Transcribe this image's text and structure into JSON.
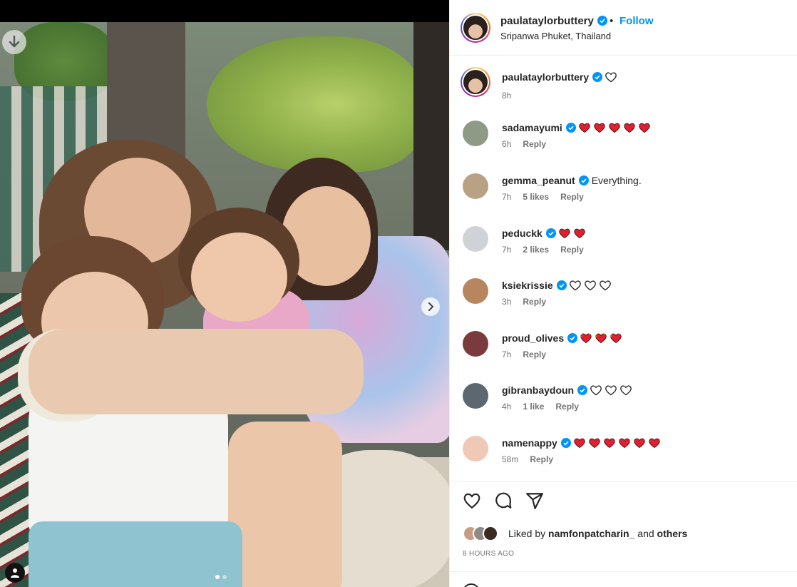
{
  "post": {
    "author": "paulataylorbuttery",
    "location": "Sripanwa Phuket, Thailand",
    "separator": "•",
    "follow_label": "Follow",
    "caption_time": "8h"
  },
  "comments": [
    {
      "username": "sadamayumi",
      "text": "",
      "hearts": 5,
      "heart_style": "red",
      "time": "6h",
      "likes": "",
      "reply": "Reply",
      "avatar_color": "#8f9a86"
    },
    {
      "username": "gemma_peanut",
      "text": "Everything.",
      "hearts": 0,
      "heart_style": "",
      "time": "7h",
      "likes": "5 likes",
      "reply": "Reply",
      "avatar_color": "#b9a184"
    },
    {
      "username": "peduckk",
      "text": "",
      "hearts": 2,
      "heart_style": "red",
      "time": "7h",
      "likes": "2 likes",
      "reply": "Reply",
      "avatar_color": "#cfd3d8"
    },
    {
      "username": "ksiekrissie",
      "text": "",
      "hearts": 3,
      "heart_style": "outline",
      "time": "3h",
      "likes": "",
      "reply": "Reply",
      "avatar_color": "#b7865f"
    },
    {
      "username": "proud_olives",
      "text": "",
      "hearts": 3,
      "heart_style": "sparkle",
      "time": "7h",
      "likes": "",
      "reply": "Reply",
      "avatar_color": "#7a3b3f"
    },
    {
      "username": "gibranbaydoun",
      "text": "",
      "hearts": 3,
      "heart_style": "outline",
      "time": "4h",
      "likes": "1 like",
      "reply": "Reply",
      "avatar_color": "#5d6770"
    },
    {
      "username": "namenappy",
      "text": "",
      "hearts": 6,
      "heart_style": "red",
      "time": "58m",
      "likes": "",
      "reply": "Reply",
      "avatar_color": "#f0c8b6"
    }
  ],
  "likes": {
    "prefix": "Liked by",
    "user": "namfonpatcharin_",
    "and": "and",
    "others": "others"
  },
  "timestamp": "8 HOURS AGO",
  "colors": {
    "link_blue": "#0095f6",
    "verified_blue": "#0095f6",
    "heart_red": "#e0202e"
  },
  "icons": {
    "download": "download-arrow-icon",
    "next": "chevron-right-icon",
    "user_tag": "user-tag-icon",
    "like": "heart-outline-icon",
    "comment": "comment-bubble-icon",
    "share": "paper-plane-icon"
  }
}
